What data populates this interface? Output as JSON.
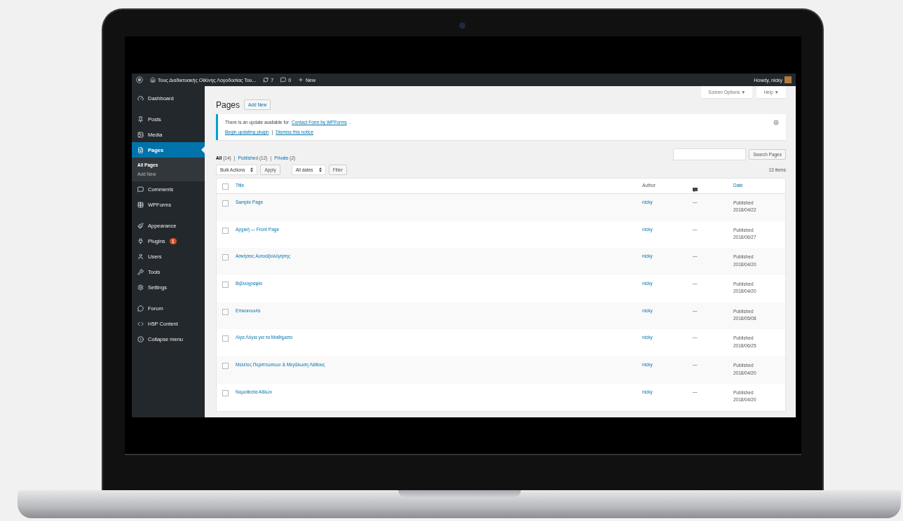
{
  "admin_bar": {
    "site_title": "Τους Διαδικτυακής Οθόνης Λογοδοσίας Του...",
    "updates_count": "7",
    "comments_count": "0",
    "new_label": "New",
    "greeting": "Howdy, nicky"
  },
  "sidebar": {
    "groups": [
      {
        "items": [
          {
            "label": "Dashboard",
            "selected": false
          }
        ]
      },
      {
        "items": [
          {
            "label": "Posts",
            "selected": false
          },
          {
            "label": "Media",
            "selected": false
          },
          {
            "label": "Pages",
            "selected": true,
            "children": [
              {
                "label": "All Pages",
                "selected": true
              },
              {
                "label": "Add New",
                "selected": false
              }
            ]
          },
          {
            "label": "Comments",
            "selected": false
          },
          {
            "label": "WPForms",
            "selected": false
          }
        ]
      },
      {
        "items": [
          {
            "label": "Appearance",
            "selected": false
          },
          {
            "label": "Plugins",
            "selected": false,
            "badge": "1"
          },
          {
            "label": "Users",
            "selected": false
          },
          {
            "label": "Tools",
            "selected": false
          },
          {
            "label": "Settings",
            "selected": false
          }
        ]
      },
      {
        "items": [
          {
            "label": "Forum",
            "selected": false
          },
          {
            "label": "H5P Content",
            "selected": false
          },
          {
            "label": "Collapse menu",
            "selected": false
          }
        ]
      }
    ]
  },
  "screen_options": "Screen Options ▼",
  "help": "Help ▼",
  "heading": "Pages",
  "add_new": "Add New",
  "notice": {
    "message": "There is an update available for ",
    "link": "Contact Form by WPForms",
    "message_end": ".",
    "actions": [
      "Begin updating plugin",
      "Dismiss this notice"
    ],
    "separator": "|"
  },
  "filter_separator": "|",
  "filters": [
    {
      "label": "All",
      "count": "(14)",
      "selected": true
    },
    {
      "label": "Published",
      "count": "(12)",
      "selected": false
    },
    {
      "label": "Private",
      "count": "(2)",
      "selected": false
    }
  ],
  "search_button": "Search Pages",
  "bulk_actions": "Bulk Actions",
  "apply": "Apply",
  "date_filter": "All dates",
  "filter": "Filter",
  "items_count": "13 items",
  "table": {
    "select_all_checked": false,
    "columns": {
      "title": "Title",
      "author": "Author",
      "date": "Date"
    },
    "rows": [
      {
        "title": "Sample Page",
        "checked": false,
        "author": "nicky",
        "comments": "—",
        "status": "Published",
        "date": "2018/04/22"
      },
      {
        "title": "Αρχική — Front Page",
        "checked": false,
        "author": "nicky",
        "comments": "—",
        "status": "Published",
        "date": "2018/06/27"
      },
      {
        "title": "Ασκήσεις Αυτοαξιολόγησης",
        "checked": false,
        "author": "nicky",
        "comments": "—",
        "status": "Published",
        "date": "2018/04/20"
      },
      {
        "title": "Βιβλιογραφία",
        "checked": false,
        "author": "nicky",
        "comments": "—",
        "status": "Published",
        "date": "2018/04/20"
      },
      {
        "title": "Επικοινωνία",
        "checked": false,
        "author": "nicky",
        "comments": "—",
        "status": "Published",
        "date": "2018/05/08"
      },
      {
        "title": "Λίγα Λόγια για τα Μαθήματα",
        "checked": false,
        "author": "nicky",
        "comments": "—",
        "status": "Published",
        "date": "2018/06/25"
      },
      {
        "title": "Μελέτες Περιπτώσεων & Μεγάλωση Λάθους",
        "checked": false,
        "author": "nicky",
        "comments": "—",
        "status": "Published",
        "date": "2018/04/20"
      },
      {
        "title": "Νομοθεσία Αθλών",
        "checked": false,
        "author": "nicky",
        "comments": "—",
        "status": "Published",
        "date": "2018/04/20"
      }
    ]
  }
}
